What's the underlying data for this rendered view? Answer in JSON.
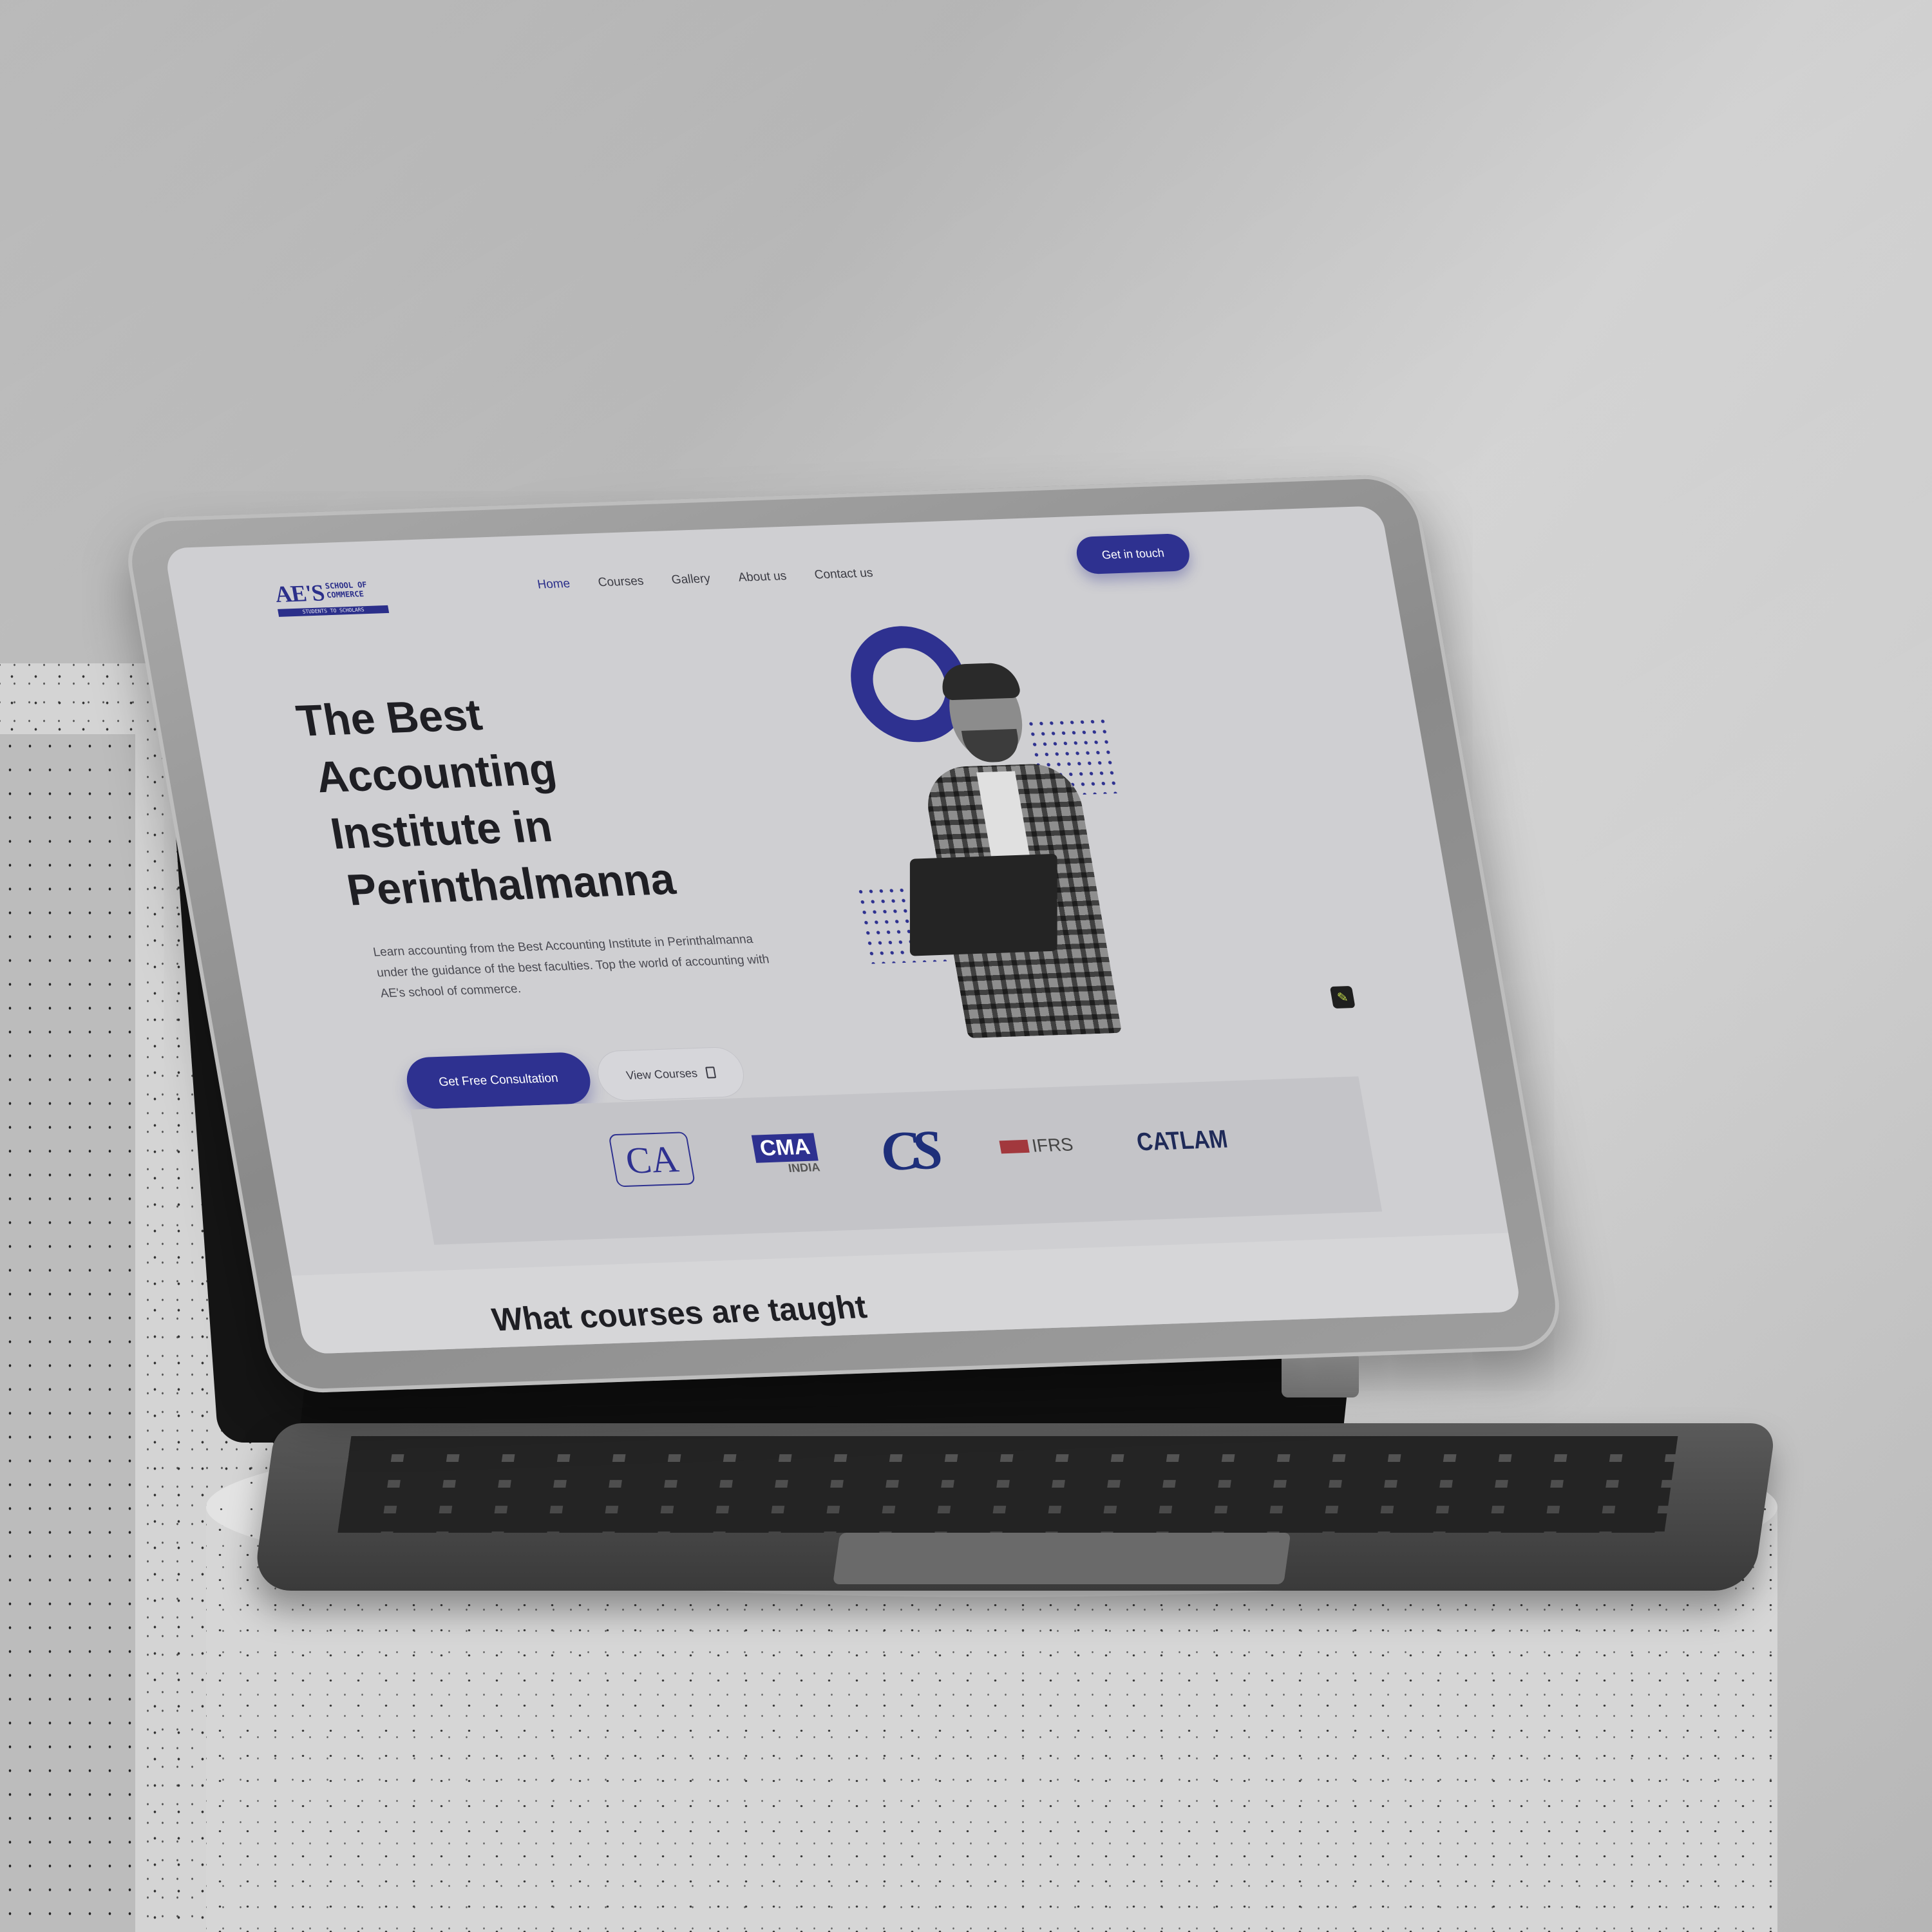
{
  "site": {
    "logo": {
      "main": "AE'S",
      "side_line1": "SCHOOL OF",
      "side_line2": "COMMERCE",
      "tagline": "STUDENTS TO SCHOLARS"
    },
    "nav": [
      {
        "label": "Home",
        "active": true
      },
      {
        "label": "Courses",
        "active": false
      },
      {
        "label": "Gallery",
        "active": false
      },
      {
        "label": "About us",
        "active": false
      },
      {
        "label": "Contact us",
        "active": false
      }
    ],
    "cta_top": "Get in touch",
    "hero": {
      "title_lines": [
        "The Best",
        "Accounting",
        "Institute in",
        "Perinthalmanna"
      ],
      "description": "Learn accounting from the Best Accounting Institute in Perinthalmanna under the guidance of the best faculties. Top the world of accounting with AE's school of commerce.",
      "primary_button": "Get Free Consultation",
      "secondary_button": "View Courses"
    },
    "partner_logos": {
      "ca": "CA",
      "cma_main": "CMA",
      "cma_sub": "INDIA",
      "cs": "CS",
      "ifrs": "IFRS",
      "catlam": "CATLAM"
    },
    "next_section_title": "What courses are taught",
    "icons": {
      "edit": "pencil-icon",
      "view_courses": "book-icon"
    }
  },
  "colors": {
    "accent": "#2e3190",
    "text_dark": "#1f1f24",
    "screen_bg": "#cfcfd2",
    "ifrs_red": "#a2383d"
  }
}
